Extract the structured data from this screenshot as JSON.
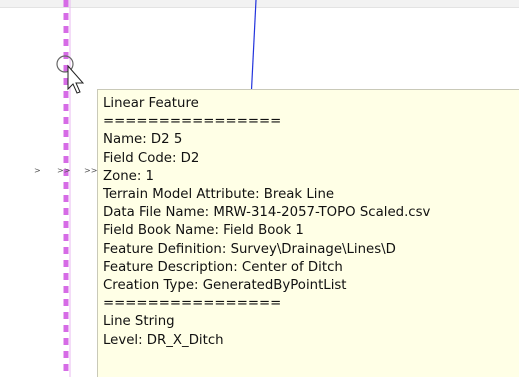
{
  "colors": {
    "tooltip_background": "#ffffe6",
    "dashed_line": "#d66be6",
    "blue_line": "#2233dd"
  },
  "cursor": {
    "icon": "arrow-pointer-icon",
    "snap_icon": "snap-circle-icon"
  },
  "markers": [
    ">",
    ">>",
    ">>"
  ],
  "tooltip": {
    "lines": [
      "Linear Feature",
      "================",
      "Name: D2 5",
      "Field Code: D2",
      "Zone: 1",
      "Terrain Model Attribute: Break Line",
      "Data File Name: MRW-314-2057-TOPO Scaled.csv",
      "Field Book Name: Field Book 1",
      "Feature Definition: Survey\\Drainage\\Lines\\D",
      "Feature Description: Center of Ditch",
      "Creation Type: GeneratedByPointList",
      "================",
      "Line String",
      "Level: DR_X_Ditch"
    ]
  }
}
